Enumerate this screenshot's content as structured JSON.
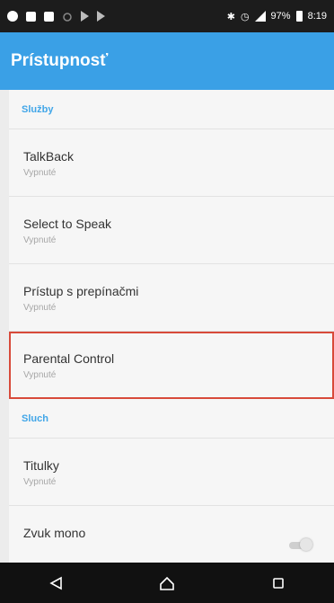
{
  "status_bar": {
    "icons_left": [
      "notification-icon",
      "image-icon",
      "message-icon",
      "cast-icon",
      "play-icon",
      "play-icon"
    ],
    "battery_text": "97%",
    "time": "8:19"
  },
  "app_bar": {
    "title": "Prístupnosť"
  },
  "sections": {
    "services": {
      "header": "Služby",
      "items": [
        {
          "title": "TalkBack",
          "subtitle": "Vypnuté"
        },
        {
          "title": "Select to Speak",
          "subtitle": "Vypnuté"
        },
        {
          "title": "Prístup s prepínačmi",
          "subtitle": "Vypnuté"
        },
        {
          "title": "Parental Control",
          "subtitle": "Vypnuté"
        }
      ]
    },
    "hearing": {
      "header": "Sluch",
      "items": [
        {
          "title": "Titulky",
          "subtitle": "Vypnuté"
        },
        {
          "title": "Zvuk mono",
          "toggle_on": false
        }
      ]
    }
  },
  "nav_bar": {
    "buttons": [
      "back-icon",
      "home-icon",
      "recents-icon"
    ]
  },
  "colors": {
    "accent": "#3aa0e6",
    "highlight": "#d84a3a"
  }
}
